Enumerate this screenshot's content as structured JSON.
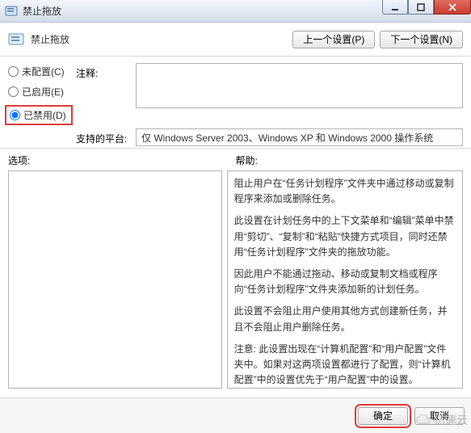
{
  "window": {
    "title": "禁止拖放"
  },
  "header": {
    "title": "禁止拖放",
    "prev_button": "上一个设置(P)",
    "next_button": "下一个设置(N)"
  },
  "config": {
    "radio_not_configured": "未配置(C)",
    "radio_enabled": "已启用(E)",
    "radio_disabled": "已禁用(D)",
    "selected": "disabled",
    "comment_label": "注释:",
    "comment_value": "",
    "platform_label": "支持的平台:",
    "platform_value": "仅 Windows Server 2003、Windows XP 和 Windows 2000 操作系统"
  },
  "labels": {
    "options": "选项:",
    "help": "帮助:"
  },
  "help_paragraphs": [
    "阻止用户在“任务计划程序”文件夹中通过移动或复制程序来添加或删除任务。",
    "此设置在计划任务中的上下文菜单和“编辑”菜单中禁用“剪切”、“复制”和“粘贴”快捷方式项目，同时还禁用“任务计划程序”文件夹的拖放功能。",
    "因此用户不能通过拖动、移动或复制文档或程序向“任务计划程序”文件夹添加新的计划任务。",
    "此设置不会阻止用户使用其他方式创建新任务，并且不会阻止用户删除任务。",
    "注意: 此设置出现在“计算机配置”和“用户配置”文件夹中。如果对这两项设置都进行了配置，则“计算机配置”中的设置优先于“用户配置”中的设置。"
  ],
  "footer": {
    "ok": "确定",
    "cancel": "取消"
  },
  "watermark": "亿速云"
}
